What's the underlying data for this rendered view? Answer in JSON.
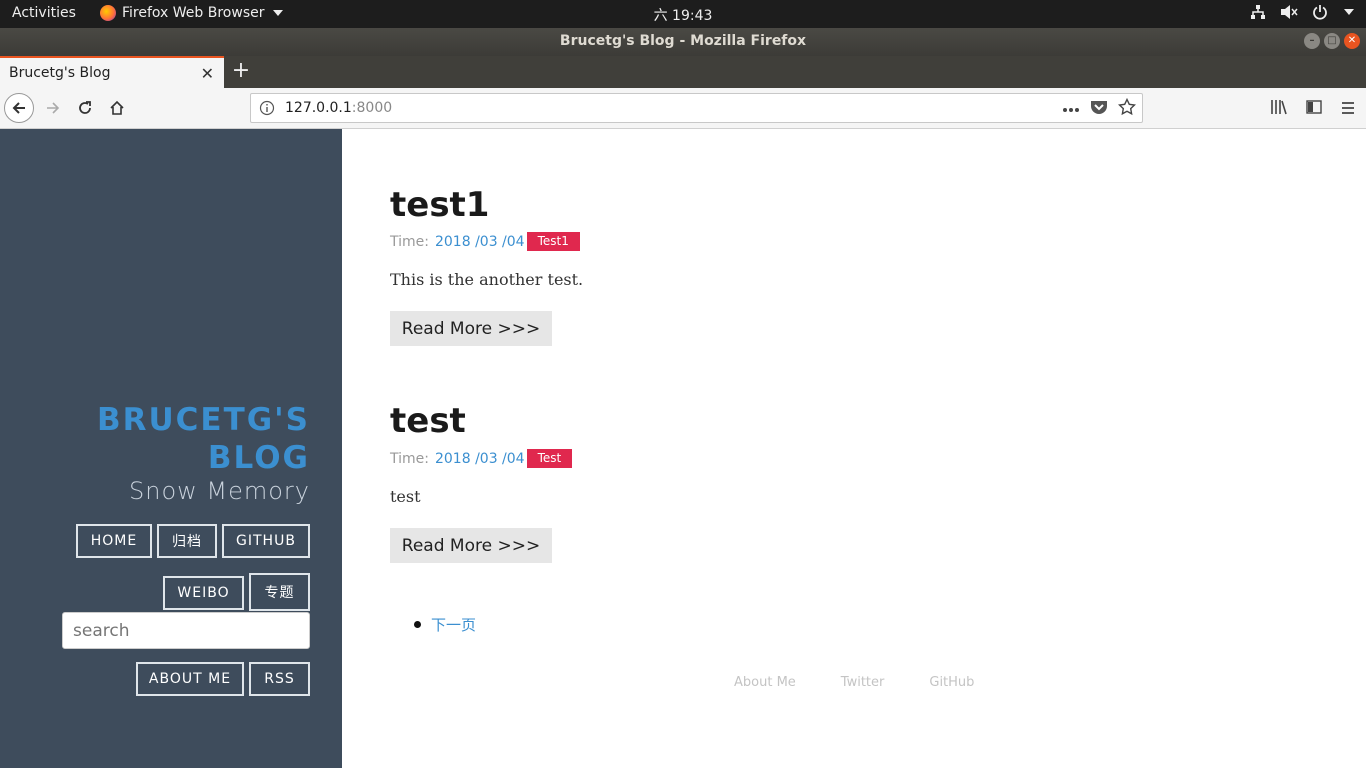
{
  "system": {
    "activities": "Activities",
    "app_menu": "Firefox Web Browser",
    "clock": "六 19:43"
  },
  "window": {
    "title": "Brucetg's Blog - Mozilla Firefox"
  },
  "tabs": [
    {
      "title": "Brucetg's Blog",
      "active": true
    }
  ],
  "navbar": {
    "url_host": "127.0.0.1",
    "url_port": ":8000"
  },
  "blog": {
    "brand_line1": "BRUCETG'S",
    "brand_line2": "BLOG",
    "tagline": "Snow Memory",
    "nav": {
      "home": "HOME",
      "archive": "归档",
      "github": "GITHUB",
      "weibo": "WEIBO",
      "topics": "专题",
      "about": "ABOUT ME",
      "rss": "RSS"
    },
    "search_placeholder": "search",
    "posts": [
      {
        "title": "test1",
        "time_label": "Time:",
        "date": "2018 /03 /04",
        "tag": "Test1",
        "excerpt": "This is the another test.",
        "read_more": "Read More >>>"
      },
      {
        "title": "test",
        "time_label": "Time:",
        "date": "2018 /03 /04",
        "tag": "Test",
        "excerpt": "test",
        "read_more": "Read More >>>"
      }
    ],
    "next_page": "下一页",
    "footer": {
      "about": "About Me",
      "twitter": "Twitter",
      "github": "GitHub"
    }
  },
  "colors": {
    "sidebar_bg": "#3e4c5c",
    "brand": "#3b8fd0",
    "tag": "#e0284e",
    "link": "#3b8fd0"
  }
}
